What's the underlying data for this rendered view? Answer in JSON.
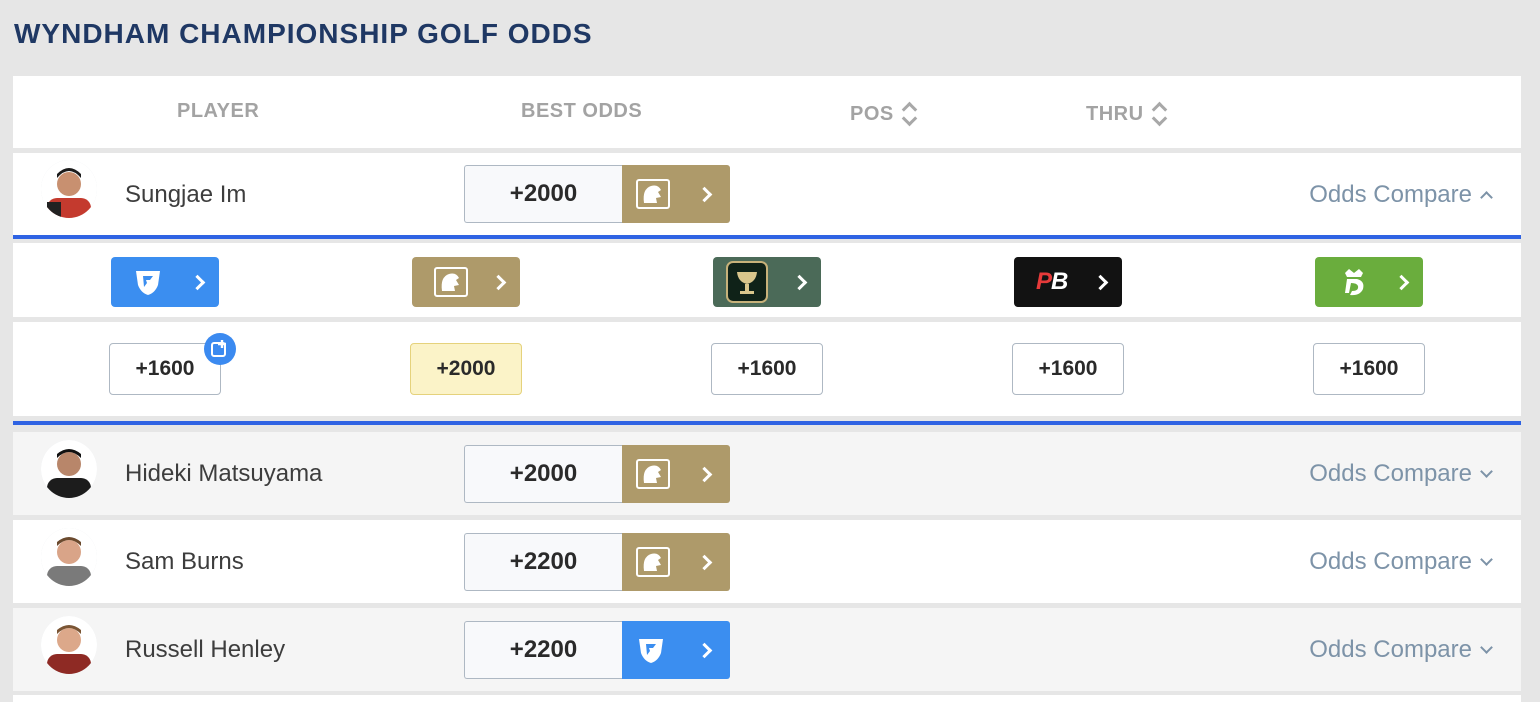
{
  "page_title": "WYNDHAM CHAMPIONSHIP GOLF ODDS",
  "columns": {
    "player": "PLAYER",
    "best_odds": "BEST ODDS",
    "pos": "POS",
    "thru": "THRU"
  },
  "players": [
    {
      "name": "Sungjae Im",
      "best_odds": "+2000",
      "book": "betmgm-logo",
      "compare_label": "Odds Compare",
      "expanded": true
    },
    {
      "name": "Hideki Matsuyama",
      "best_odds": "+2000",
      "book": "betmgm-logo",
      "compare_label": "Odds Compare",
      "expanded": false
    },
    {
      "name": "Sam Burns",
      "best_odds": "+2200",
      "book": "betmgm-logo",
      "compare_label": "Odds Compare",
      "expanded": false
    },
    {
      "name": "Russell Henley",
      "best_odds": "+2200",
      "book": "fanduel-logo",
      "compare_label": "Odds Compare",
      "expanded": false
    }
  ],
  "compare": {
    "books": [
      {
        "name": "fanduel-logo",
        "color": "#3b8ef0",
        "odds": "+1600",
        "best": false
      },
      {
        "name": "betmgm-logo",
        "color": "#ae9a6a",
        "odds": "+2000",
        "best": true
      },
      {
        "name": "caesars-logo",
        "color": "#4b6a58",
        "odds": "+1600",
        "best": false
      },
      {
        "name": "pointsbet-logo",
        "color": "#121212",
        "odds": "+1600",
        "best": false,
        "logo_text": "PB"
      },
      {
        "name": "draftkings-logo",
        "color": "#6aad3d",
        "odds": "+1600",
        "best": false
      }
    ]
  },
  "colors": {
    "title": "#1f3864",
    "accent_bar": "#2f63e3",
    "betmgm": "#ae9a6a",
    "fanduel": "#3b8ef0",
    "compare_link": "#7d93a8",
    "best_highlight": "#fbf3c8"
  }
}
